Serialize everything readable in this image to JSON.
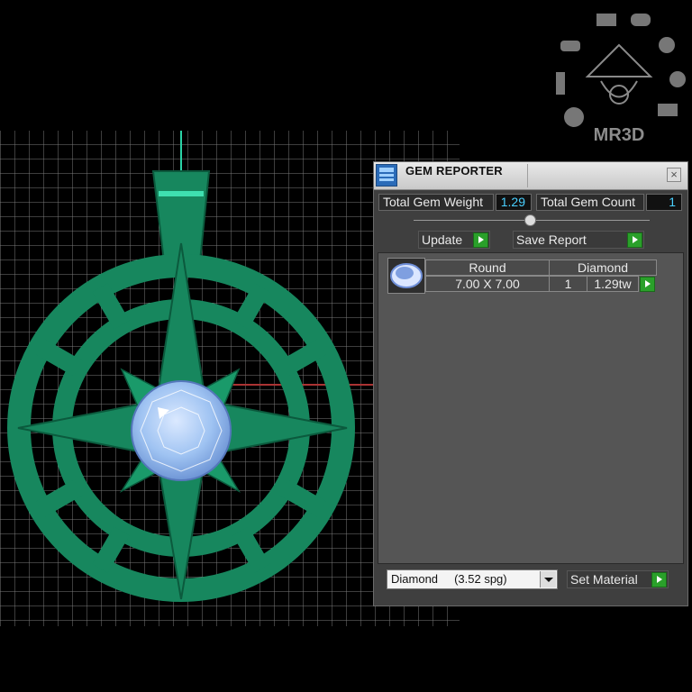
{
  "gem_reporter": {
    "title": "GEM REPORTER",
    "close_glyph": "×",
    "total_gem_weight_label": "Total Gem Weight",
    "total_gem_weight_value": "1.29",
    "total_gem_count_label": "Total Gem Count",
    "total_gem_count_value": "1",
    "update_label": "Update",
    "save_report_label": "Save Report",
    "columns": {
      "shape": "Round",
      "material": "Diamond"
    },
    "rows": [
      {
        "size": "7.00 X 7.00",
        "count": "1",
        "weight": "1.29tw"
      }
    ],
    "material_select_value": "Diamond     (3.52 spg)",
    "set_material_label": "Set Material"
  },
  "watermark": {
    "text": "MR3D"
  },
  "colors": {
    "pendant_green": "#17875e",
    "gem_blue": "#9fc3f2",
    "value_cyan": "#4ad0ff",
    "play_green": "#2aa02a"
  },
  "icons": [
    "app-icon",
    "close-icon",
    "play-icon",
    "dropdown-arrow-icon",
    "round-gem-icon"
  ]
}
